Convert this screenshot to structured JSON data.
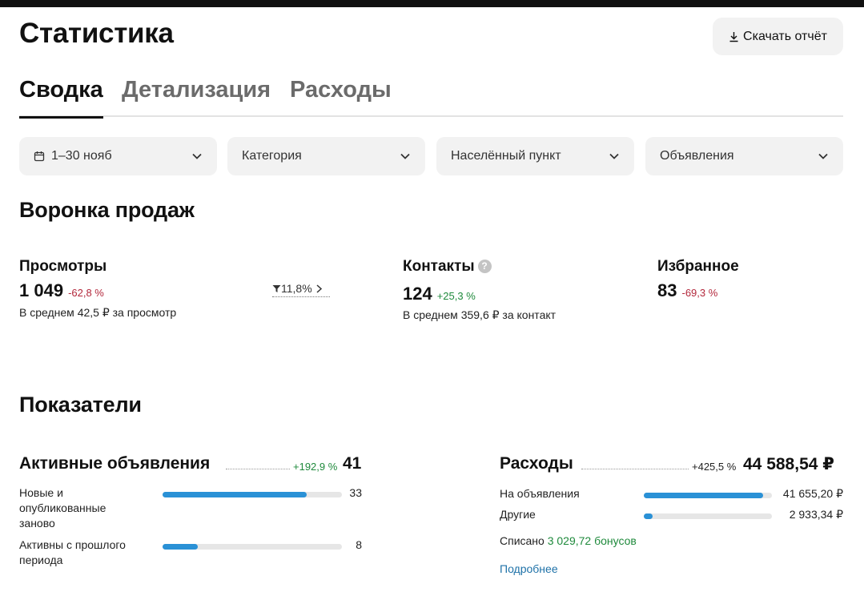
{
  "header": {
    "title": "Статистика",
    "download_label": "Скачать отчёт"
  },
  "tabs": [
    {
      "label": "Сводка",
      "active": true
    },
    {
      "label": "Детализация",
      "active": false
    },
    {
      "label": "Расходы",
      "active": false
    }
  ],
  "filters": {
    "period": "1–30 нояб",
    "category": "Категория",
    "city": "Населённый пункт",
    "ads": "Объявления"
  },
  "funnel": {
    "title": "Воронка продаж",
    "views": {
      "label": "Просмотры",
      "value": "1 049",
      "delta": "-62,8 %",
      "avg": "В среднем 42,5 ₽ за просмотр",
      "conversion": "11,8%"
    },
    "contacts": {
      "label": "Контакты",
      "value": "124",
      "delta": "+25,3 %",
      "avg": "В среднем 359,6 ₽ за контакт"
    },
    "favorites": {
      "label": "Избранное",
      "value": "83",
      "delta": "-69,3 %"
    }
  },
  "indicators": {
    "title": "Показатели",
    "active_ads": {
      "title": "Активные объявления",
      "delta": "+192,9 %",
      "total": "41",
      "rows": [
        {
          "label": "Новые и опубликованные заново",
          "value": "33",
          "fraction": 0.805
        },
        {
          "label": "Активны с прошлого периода",
          "value": "8",
          "fraction": 0.195
        }
      ]
    },
    "expenses": {
      "title": "Расходы",
      "delta": "+425,5 %",
      "total": "44 588,54 ₽",
      "rows": [
        {
          "label": "На объявления",
          "value": "41 655,20 ₽",
          "fraction": 0.934
        },
        {
          "label": "Другие",
          "value": "2 933,34 ₽",
          "fraction": 0.066
        }
      ],
      "written_off_label": "Списано",
      "written_off_bonus": "3 029,72 бонусов",
      "more_link": "Подробнее"
    }
  },
  "colors": {
    "accent_bar": "#2a91d6",
    "negative": "#b3283c",
    "positive": "#1f8a3c",
    "link": "#1f72a8"
  }
}
